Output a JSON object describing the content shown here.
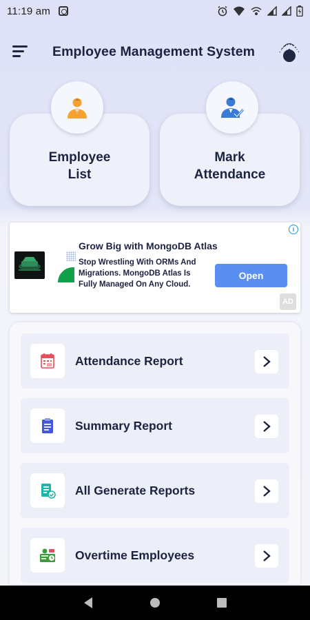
{
  "status_bar": {
    "time": "11:19 am"
  },
  "header": {
    "title": "Employee Management System"
  },
  "cards": [
    {
      "label": "Employee\nList",
      "icon": "employee-icon",
      "color": "#f4a233"
    },
    {
      "label": "Mark\nAttendance",
      "icon": "employee-check-icon",
      "color": "#3a7bd5"
    }
  ],
  "ad": {
    "title": "Grow Big with MongoDB Atlas",
    "text": "Stop Wrestling With ORMs And Migrations. MongoDB Atlas Is Fully Managed On Any Cloud.",
    "button_label": "Open",
    "badge": "AD",
    "info": "i"
  },
  "reports": [
    {
      "label": "Attendance Report",
      "icon": "calendar-report-icon",
      "color": "#e54e5b"
    },
    {
      "label": "Summary Report",
      "icon": "clipboard-icon",
      "color": "#4257d9"
    },
    {
      "label": "All Generate Reports",
      "icon": "document-check-icon",
      "color": "#1fb4a8"
    },
    {
      "label": "Overtime Employees",
      "icon": "overtime-icon",
      "color": "#3d9a3d"
    }
  ],
  "colors": {
    "title": "#1c2340",
    "ad_button": "#5a8ef0",
    "card_bg": "#eff1fa"
  }
}
